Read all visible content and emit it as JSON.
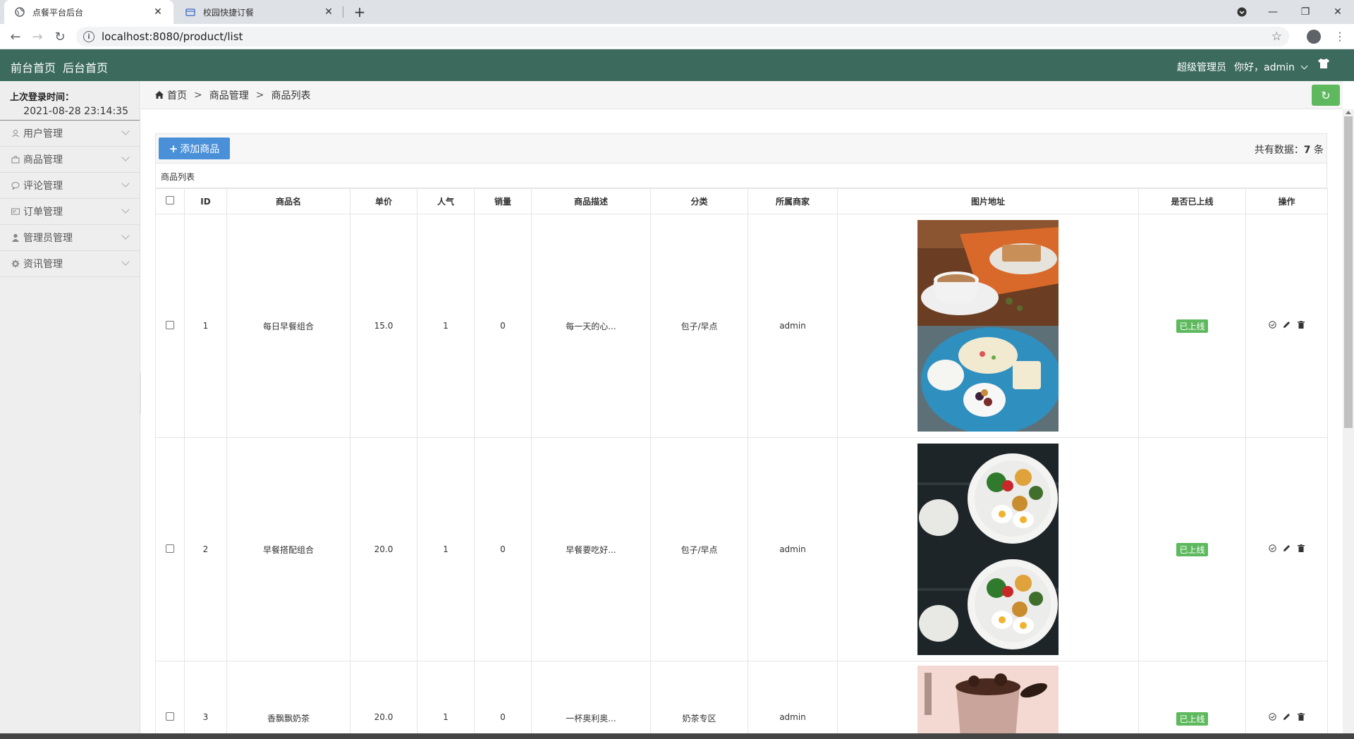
{
  "browser": {
    "tabs": [
      {
        "title": "点餐平台后台",
        "active": true
      },
      {
        "title": "校园快捷订餐",
        "active": false
      }
    ],
    "url": "localhost:8080/product/list"
  },
  "header": {
    "front_home": "前台首页",
    "back_home": "后台首页",
    "role": "超级管理员",
    "greeting": "你好，admin"
  },
  "sidebar": {
    "last_login_label": "上次登录时间：",
    "last_login_value": "2021-08-28 23:14:35",
    "items": [
      {
        "label": "用户管理",
        "icon": "user-icon"
      },
      {
        "label": "商品管理",
        "icon": "bag-icon"
      },
      {
        "label": "评论管理",
        "icon": "comment-icon"
      },
      {
        "label": "订单管理",
        "icon": "order-icon"
      },
      {
        "label": "管理员管理",
        "icon": "admin-icon"
      },
      {
        "label": "资讯管理",
        "icon": "gear-icon"
      }
    ]
  },
  "breadcrumb": [
    "首页",
    "商品管理",
    "商品列表"
  ],
  "toolbar": {
    "add_label": "添加商品",
    "total_prefix": "共有数据：",
    "total_count": "7",
    "total_suffix": " 条"
  },
  "table": {
    "caption": "商品列表",
    "columns": [
      "ID",
      "商品名",
      "单价",
      "人气",
      "销量",
      "商品描述",
      "分类",
      "所属商家",
      "图片地址",
      "是否已上线",
      "操作"
    ],
    "rows": [
      {
        "id": "1",
        "name": "每日早餐组合",
        "price": "15.0",
        "popularity": "1",
        "sales": "0",
        "desc": "每一天的心...",
        "category": "包子/早点",
        "merchant": "admin",
        "status": "已上线"
      },
      {
        "id": "2",
        "name": "早餐搭配组合",
        "price": "20.0",
        "popularity": "1",
        "sales": "0",
        "desc": "早餐要吃好...",
        "category": "包子/早点",
        "merchant": "admin",
        "status": "已上线"
      },
      {
        "id": "3",
        "name": "香飘飘奶茶",
        "price": "20.0",
        "popularity": "1",
        "sales": "0",
        "desc": "一杯奥利奥...",
        "category": "奶茶专区",
        "merchant": "admin",
        "status": "已上线"
      }
    ]
  },
  "colors": {
    "header_bg": "#3c6b5e",
    "primary_button": "#4a90d9",
    "success": "#5eb95e"
  }
}
